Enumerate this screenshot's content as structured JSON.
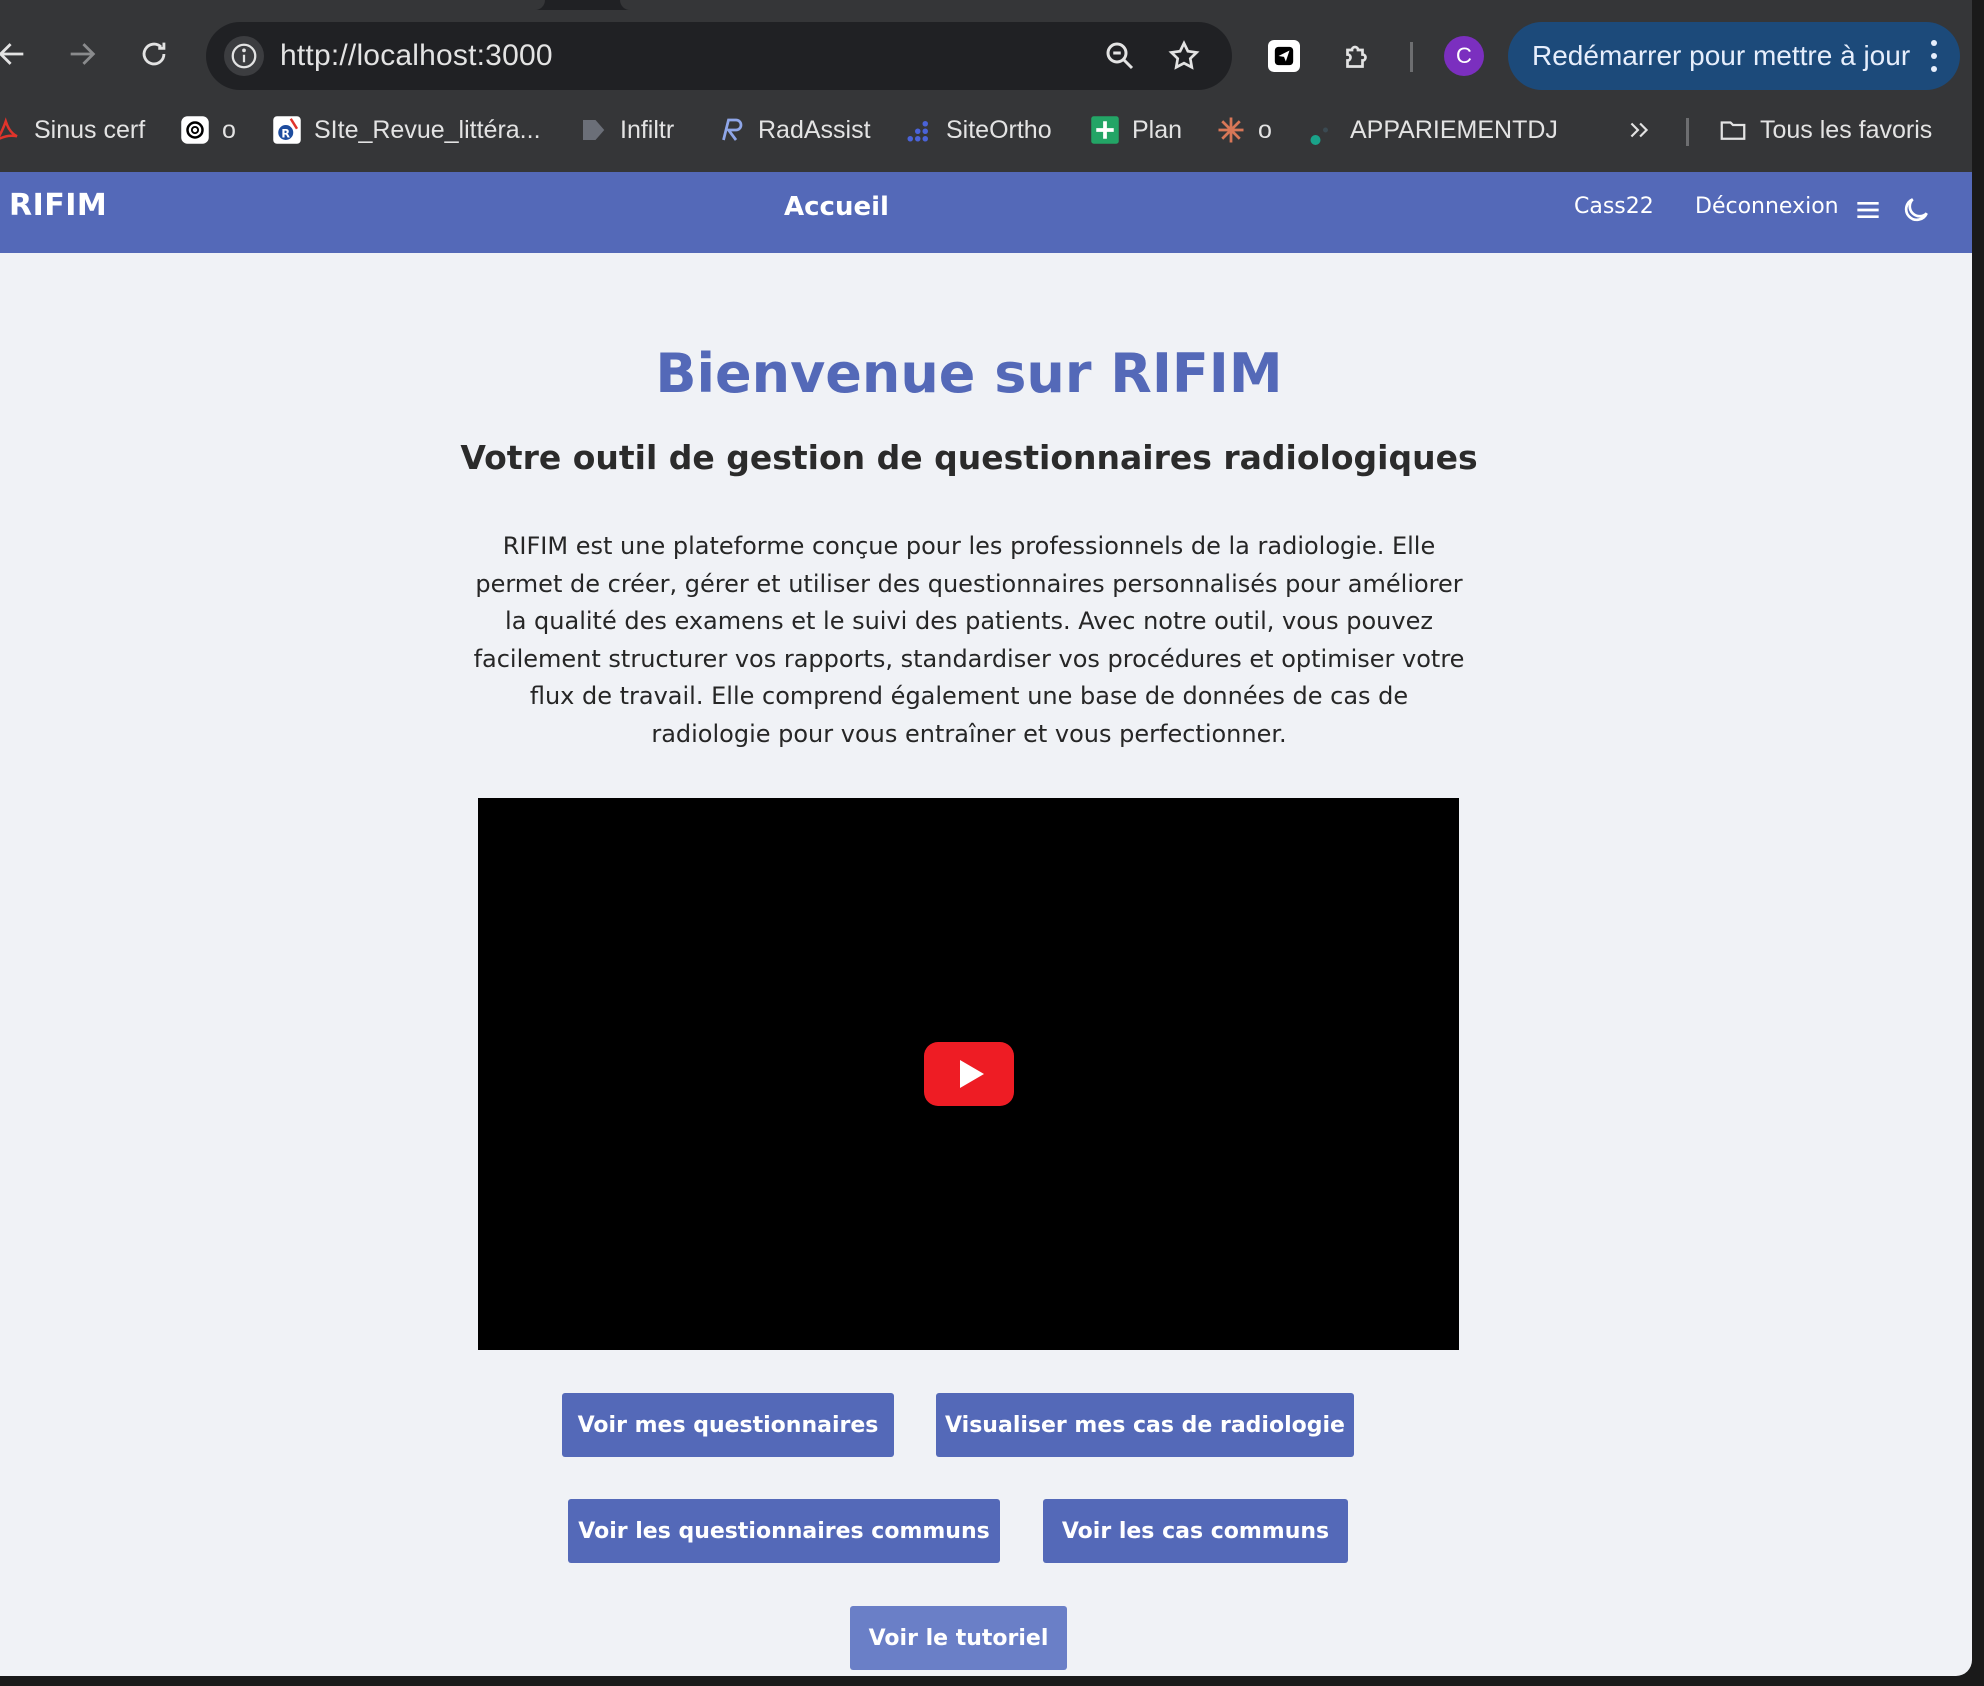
{
  "browser": {
    "url": "http://localhost:3000",
    "profile_initial": "C",
    "update_label": "Redémarrer pour mettre à jour",
    "bookmarks": [
      {
        "label": "Sinus cerf",
        "icon": "pdf-icon"
      },
      {
        "label": "o",
        "icon": "openai-icon"
      },
      {
        "label": "SIte_Revue_littéra...",
        "icon": "radiopaedia-icon"
      },
      {
        "label": "Infiltr",
        "icon": "arrow-tag-icon"
      },
      {
        "label": "RadAssist",
        "icon": "radassist-icon"
      },
      {
        "label": "SiteOrtho",
        "icon": "dots-icon"
      },
      {
        "label": "Plan",
        "icon": "sheets-plus-icon"
      },
      {
        "label": "o",
        "icon": "claude-icon"
      },
      {
        "label": "APPARIEMENTDJ",
        "icon": "dot-icon"
      }
    ],
    "overflow_label": "»",
    "all_bookmarks_label": "Tous les favoris"
  },
  "navbar": {
    "brand": "RIFIM",
    "center": "Accueil",
    "user": "Cass22",
    "logout": "Déconnexion"
  },
  "hero": {
    "title": "Bienvenue sur RIFIM",
    "subtitle": "Votre outil de gestion de questionnaires radiologiques",
    "description": "RIFIM est une plateforme conçue pour les professionnels de la radiologie. Elle permet de créer, gérer et utiliser des questionnaires personnalisés pour améliorer la qualité des examens et le suivi des patients. Avec notre outil, vous pouvez facilement structurer vos rapports, standardiser vos procédures et optimiser votre flux de travail. Elle comprend également une base de données de cas de radiologie pour vous entraîner et vous perfectionner."
  },
  "buttons": {
    "my_questionnaires": "Voir mes questionnaires",
    "my_cases": "Visualiser mes cas de radiologie",
    "common_questionnaires": "Voir les questionnaires communs",
    "common_cases": "Voir les cas communs",
    "tutorial": "Voir le tutoriel"
  },
  "colors": {
    "primary": "#5469b8",
    "page_background": "#f0f2f6",
    "youtube_red": "#ee1c24",
    "chrome_update": "#1c4a7a"
  }
}
